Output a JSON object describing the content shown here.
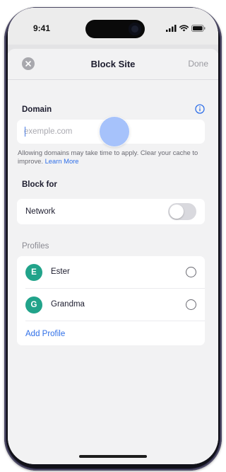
{
  "status_bar": {
    "time": "9:41",
    "icons": [
      "signal-icon",
      "wifi-icon",
      "battery-icon"
    ]
  },
  "navbar": {
    "title": "Block Site",
    "done_label": "Done",
    "close_icon": "close-icon"
  },
  "domain": {
    "label": "Domain",
    "info_icon": "info-icon",
    "placeholder": "exemple.com",
    "value": "",
    "help_text": "Allowing domains may take time to apply. Clear your cache to improve.",
    "help_link": "Learn More"
  },
  "block_for": {
    "label": "Block for",
    "network_label": "Network",
    "network_enabled": false
  },
  "profiles": {
    "caption": "Profiles",
    "items": [
      {
        "initial": "E",
        "name": "Ester",
        "selected": false
      },
      {
        "initial": "G",
        "name": "Grandma",
        "selected": false
      }
    ],
    "add_label": "Add Profile"
  },
  "colors": {
    "accent": "#2f6fe8",
    "avatar": "#21a38a",
    "touch_indicator": "#a6c2fb"
  }
}
